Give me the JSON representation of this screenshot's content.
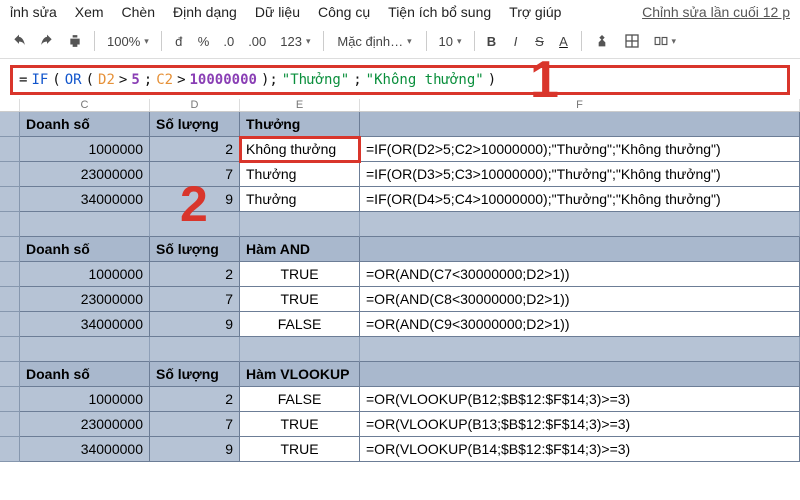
{
  "menu": {
    "items": [
      "ỉnh sửa",
      "Xem",
      "Chèn",
      "Định dạng",
      "Dữ liệu",
      "Công cụ",
      "Tiện ích bổ sung",
      "Trợ giúp"
    ],
    "last_edit": "Chỉnh sửa lần cuối 12 p"
  },
  "toolbar": {
    "zoom": "100%",
    "currency1": "đ",
    "currency2": "%",
    "dec_dec": ".0",
    "dec_inc": ".00",
    "fmt": "123",
    "font": "Mặc định…",
    "fontsize": "10",
    "bold": "B",
    "italic": "I",
    "strike": "S",
    "textcolor": "A"
  },
  "formula_bar": {
    "parts": [
      {
        "c": "f-black",
        "t": "="
      },
      {
        "c": "f-blue",
        "t": "IF"
      },
      {
        "c": "f-black",
        "t": "("
      },
      {
        "c": "f-blue",
        "t": "OR"
      },
      {
        "c": "f-black",
        "t": "("
      },
      {
        "c": "f-orange",
        "t": "D2"
      },
      {
        "c": "f-black",
        "t": ">"
      },
      {
        "c": "f-purple",
        "t": "5"
      },
      {
        "c": "f-black",
        "t": ";"
      },
      {
        "c": "f-orange",
        "t": "C2"
      },
      {
        "c": "f-black",
        "t": ">"
      },
      {
        "c": "f-purple",
        "t": "10000000"
      },
      {
        "c": "f-black",
        "t": ");"
      },
      {
        "c": "f-green",
        "t": "\"Thưởng\""
      },
      {
        "c": "f-black",
        "t": ";"
      },
      {
        "c": "f-green",
        "t": "\"Không thưởng\""
      },
      {
        "c": "f-black",
        "t": ")"
      }
    ]
  },
  "col_headers": {
    "c": "C",
    "d": "D",
    "e": "E",
    "f": "F"
  },
  "section1": {
    "h1": "Doanh số",
    "h2": "Số lượng",
    "h3": "Thưởng",
    "rows": [
      {
        "ds": "1000000",
        "sl": "2",
        "th": "Không thưởng",
        "fm": "=IF(OR(D2>5;C2>10000000);\"Thưởng\";\"Không thưởng\")",
        "hl": true
      },
      {
        "ds": "23000000",
        "sl": "7",
        "th": "Thưởng",
        "fm": "=IF(OR(D3>5;C3>10000000);\"Thưởng\";\"Không thưởng\")"
      },
      {
        "ds": "34000000",
        "sl": "9",
        "th": "Thưởng",
        "fm": "=IF(OR(D4>5;C4>10000000);\"Thưởng\";\"Không thưởng\")"
      }
    ]
  },
  "section2": {
    "h1": "Doanh số",
    "h2": "Số lượng",
    "h3": "Hàm AND",
    "rows": [
      {
        "ds": "1000000",
        "sl": "2",
        "th": "TRUE",
        "fm": "=OR(AND(C7<30000000;D2>1))"
      },
      {
        "ds": "23000000",
        "sl": "7",
        "th": "TRUE",
        "fm": "=OR(AND(C8<30000000;D2>1))"
      },
      {
        "ds": "34000000",
        "sl": "9",
        "th": "FALSE",
        "fm": "=OR(AND(C9<30000000;D2>1))"
      }
    ]
  },
  "section3": {
    "h1": "Doanh số",
    "h2": "Số lượng",
    "h3": "Hàm VLOOKUP",
    "rows": [
      {
        "ds": "1000000",
        "sl": "2",
        "th": "FALSE",
        "fm": "=OR(VLOOKUP(B12;$B$12:$F$14;3)>=3)"
      },
      {
        "ds": "23000000",
        "sl": "7",
        "th": "TRUE",
        "fm": "=OR(VLOOKUP(B13;$B$12:$F$14;3)>=3)"
      },
      {
        "ds": "34000000",
        "sl": "9",
        "th": "TRUE",
        "fm": "=OR(VLOOKUP(B14;$B$12:$F$14;3)>=3)"
      }
    ]
  },
  "annotations": {
    "one": "1",
    "two": "2"
  }
}
